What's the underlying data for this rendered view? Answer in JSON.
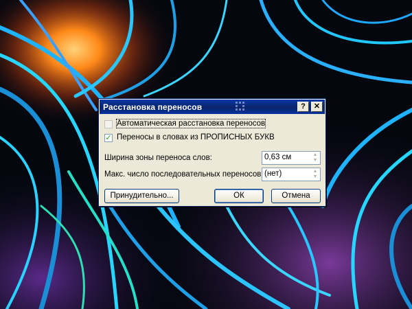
{
  "dialog": {
    "title": "Расстановка переносов",
    "help_glyph": "?",
    "close_glyph": "✕",
    "auto_hyphenation": {
      "label": "Автоматическая расстановка переносов",
      "checked": false
    },
    "hyphenate_caps": {
      "label": "Переносы в словах из ПРОПИСНЫХ БУКВ",
      "checked": true
    },
    "zone_width": {
      "label": "Ширина зоны переноса слов:",
      "value": "0,63 см"
    },
    "max_consecutive": {
      "label": "Макс. число последовательных переносов:",
      "value": "(нет)"
    },
    "buttons": {
      "manual": "Принудительно...",
      "ok": "ОК",
      "cancel": "Отмена"
    },
    "check_glyph": "✓",
    "up_arrow": "▲",
    "down_arrow": "▼"
  },
  "colors": {
    "titlebar": "#0a246a",
    "dialog_bg": "#ece9d8",
    "wallpaper_base": "#05070f",
    "wallpaper_accent": "#1fb3ff",
    "wallpaper_glow": "#ff8a1a"
  },
  "icons": [
    "help-icon",
    "close-icon",
    "check-icon",
    "spin-up-icon",
    "spin-down-icon"
  ]
}
